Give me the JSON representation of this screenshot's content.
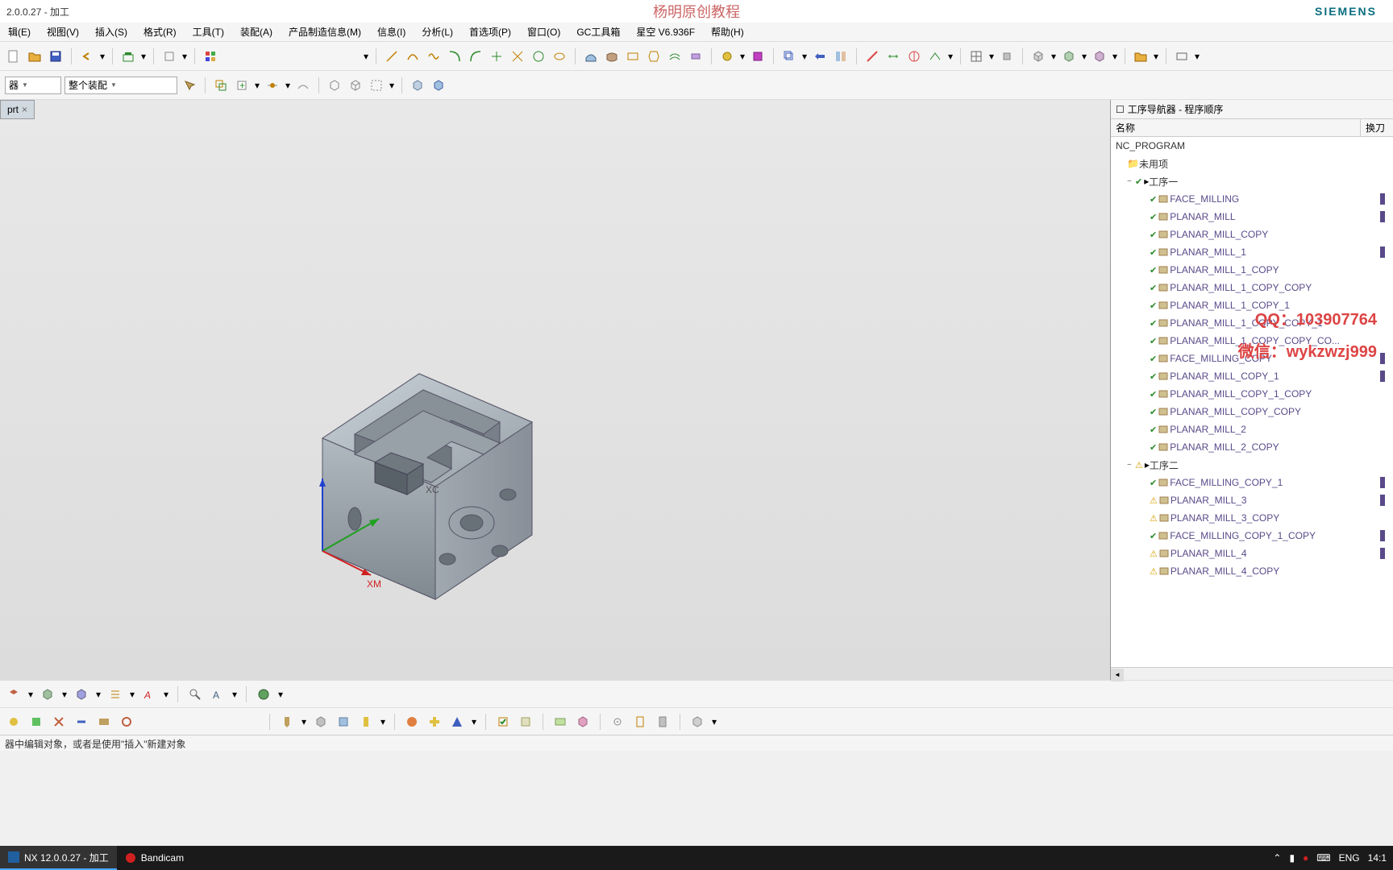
{
  "title": "2.0.0.27 - 加工",
  "watermark_top": "杨明原创教程",
  "brand": "SIEMENS",
  "menu": [
    "辑(E)",
    "视图(V)",
    "插入(S)",
    "格式(R)",
    "工具(T)",
    "装配(A)",
    "产品制造信息(M)",
    "信息(I)",
    "分析(L)",
    "首选项(P)",
    "窗口(O)",
    "GC工具箱",
    "星空 V6.936F",
    "帮助(H)"
  ],
  "combo1": "器",
  "combo2": "整个装配",
  "tab_name": "prt",
  "panel_title": "工序导航器 - 程序顺序",
  "col_name": "名称",
  "col_tool": "换刀",
  "tree": {
    "root": "NC_PROGRAM",
    "unused": "未用项",
    "groups": [
      {
        "name": "工序一",
        "status": "check",
        "ops": [
          {
            "name": "FACE_MILLING",
            "status": "check",
            "tool": true
          },
          {
            "name": "PLANAR_MILL",
            "status": "check",
            "tool": true
          },
          {
            "name": "PLANAR_MILL_COPY",
            "status": "check",
            "tool": false
          },
          {
            "name": "PLANAR_MILL_1",
            "status": "check",
            "tool": true
          },
          {
            "name": "PLANAR_MILL_1_COPY",
            "status": "check",
            "tool": false
          },
          {
            "name": "PLANAR_MILL_1_COPY_COPY",
            "status": "check",
            "tool": false
          },
          {
            "name": "PLANAR_MILL_1_COPY_1",
            "status": "check",
            "tool": false
          },
          {
            "name": "PLANAR_MILL_1_COPY_COPY_1",
            "status": "check",
            "tool": false
          },
          {
            "name": "PLANAR_MILL_1_COPY_COPY_CO...",
            "status": "check",
            "tool": false
          },
          {
            "name": "FACE_MILLING_COPY",
            "status": "check",
            "tool": true
          },
          {
            "name": "PLANAR_MILL_COPY_1",
            "status": "check",
            "tool": true
          },
          {
            "name": "PLANAR_MILL_COPY_1_COPY",
            "status": "check",
            "tool": false
          },
          {
            "name": "PLANAR_MILL_COPY_COPY",
            "status": "check",
            "tool": false
          },
          {
            "name": "PLANAR_MILL_2",
            "status": "check",
            "tool": false
          },
          {
            "name": "PLANAR_MILL_2_COPY",
            "status": "check",
            "tool": false
          }
        ]
      },
      {
        "name": "工序二",
        "status": "warn",
        "ops": [
          {
            "name": "FACE_MILLING_COPY_1",
            "status": "check",
            "tool": true
          },
          {
            "name": "PLANAR_MILL_3",
            "status": "warn",
            "tool": true
          },
          {
            "name": "PLANAR_MILL_3_COPY",
            "status": "warn",
            "tool": false
          },
          {
            "name": "FACE_MILLING_COPY_1_COPY",
            "status": "check",
            "tool": true
          },
          {
            "name": "PLANAR_MILL_4",
            "status": "warn",
            "tool": true
          },
          {
            "name": "PLANAR_MILL_4_COPY",
            "status": "warn",
            "tool": false
          }
        ]
      }
    ]
  },
  "status_text": "器中编辑对象，或者是使用\"插入\"新建对象",
  "task_nx": "NX 12.0.0.27 - 加工",
  "task_bc": "Bandicam",
  "tray_lang": "ENG",
  "tray_time": "14:1",
  "wm_qq": "QQ：103907764",
  "wm_wx": "微信：wykzwzj999",
  "axis_labels": {
    "xm": "XM",
    "xc": "XC"
  }
}
